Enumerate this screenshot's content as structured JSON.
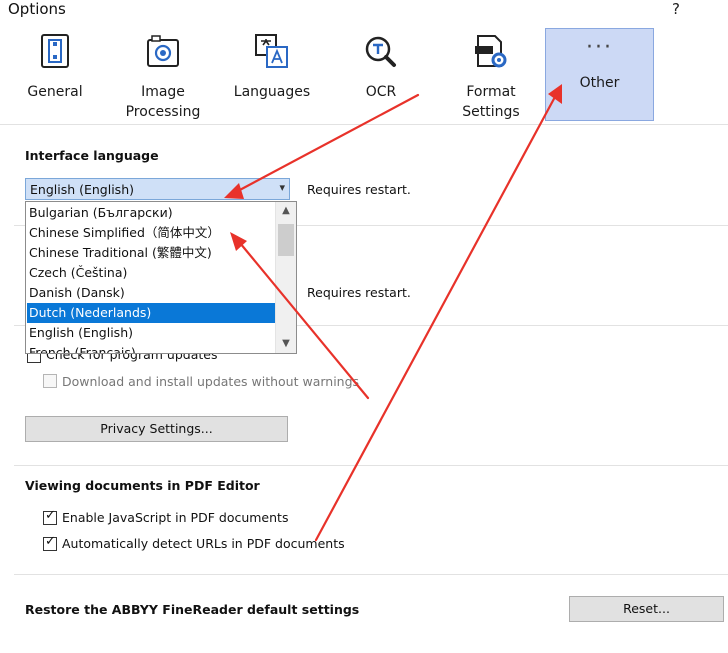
{
  "window": {
    "title": "Options",
    "help": "?"
  },
  "toolbar": {
    "items": [
      {
        "label": "General",
        "icon": "general-settings-icon"
      },
      {
        "label": "Image\nProcessing",
        "icon": "camera-icon"
      },
      {
        "label": "Languages",
        "icon": "languages-icon"
      },
      {
        "label": "OCR",
        "icon": "ocr-icon"
      },
      {
        "label": "Format\nSettings",
        "icon": "format-settings-icon"
      },
      {
        "label": "Other",
        "icon": "more-dots-icon",
        "dots": "···"
      }
    ],
    "selected": "Other"
  },
  "interface_language": {
    "title": "Interface language",
    "selected": "English (English)",
    "note": "Requires restart.",
    "options": [
      "Bulgarian (Български)",
      "Chinese Simplified（简体中文）",
      "Chinese Traditional (繁體中文)",
      "Czech (Čeština)",
      "Danish (Dansk)",
      "Dutch (Nederlands)",
      "English (English)",
      "French (Français)"
    ],
    "highlighted": "Dutch (Nederlands)"
  },
  "second_setting": {
    "note": "Requires restart."
  },
  "updates": {
    "check_label": "Check for program updates",
    "auto_label": "Download and install updates without warnings",
    "privacy_button": "Privacy Settings..."
  },
  "pdf_editor": {
    "title": "Viewing documents in PDF Editor",
    "js_label": "Enable JavaScript in PDF documents",
    "urls_label": "Automatically detect URLs in PDF documents",
    "check_mark": "✓"
  },
  "restore": {
    "title": "Restore the ABBYY FineReader default settings",
    "button": "Reset..."
  },
  "colors": {
    "selection": "#ccd9f5",
    "highlight": "#0a78d7",
    "annotation": "#e8322a"
  }
}
